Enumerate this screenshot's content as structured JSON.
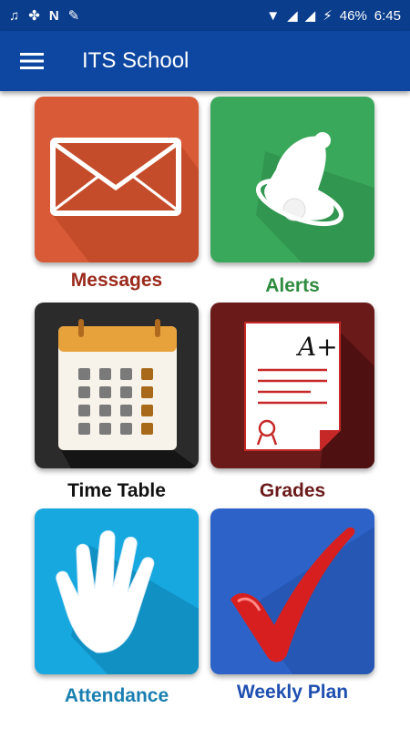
{
  "status_bar": {
    "battery": "46%",
    "time": "6:45"
  },
  "app_bar": {
    "title": "ITS School"
  },
  "tiles": [
    {
      "label": "Messages",
      "icon": "envelope-icon",
      "bg": "#d95a36",
      "label_color": "#9a2a1c"
    },
    {
      "label": "Alerts",
      "icon": "bell-icon",
      "bg": "#3aa85a",
      "label_color": "#2e8b3f"
    },
    {
      "label": "Time Table",
      "icon": "calendar-icon",
      "bg": "#2b2b2b",
      "label_color": "#111111"
    },
    {
      "label": "Grades",
      "icon": "grade-paper-icon",
      "bg": "#6b1a1a",
      "label_color": "#6b1a1a"
    },
    {
      "label": "Attendance",
      "icon": "hand-icon",
      "bg": "#17a8e0",
      "label_color": "#1a7fb0"
    },
    {
      "label": "Weekly Plan",
      "icon": "checkmark-icon",
      "bg": "#2d63c8",
      "label_color": "#1f4fb0"
    }
  ]
}
